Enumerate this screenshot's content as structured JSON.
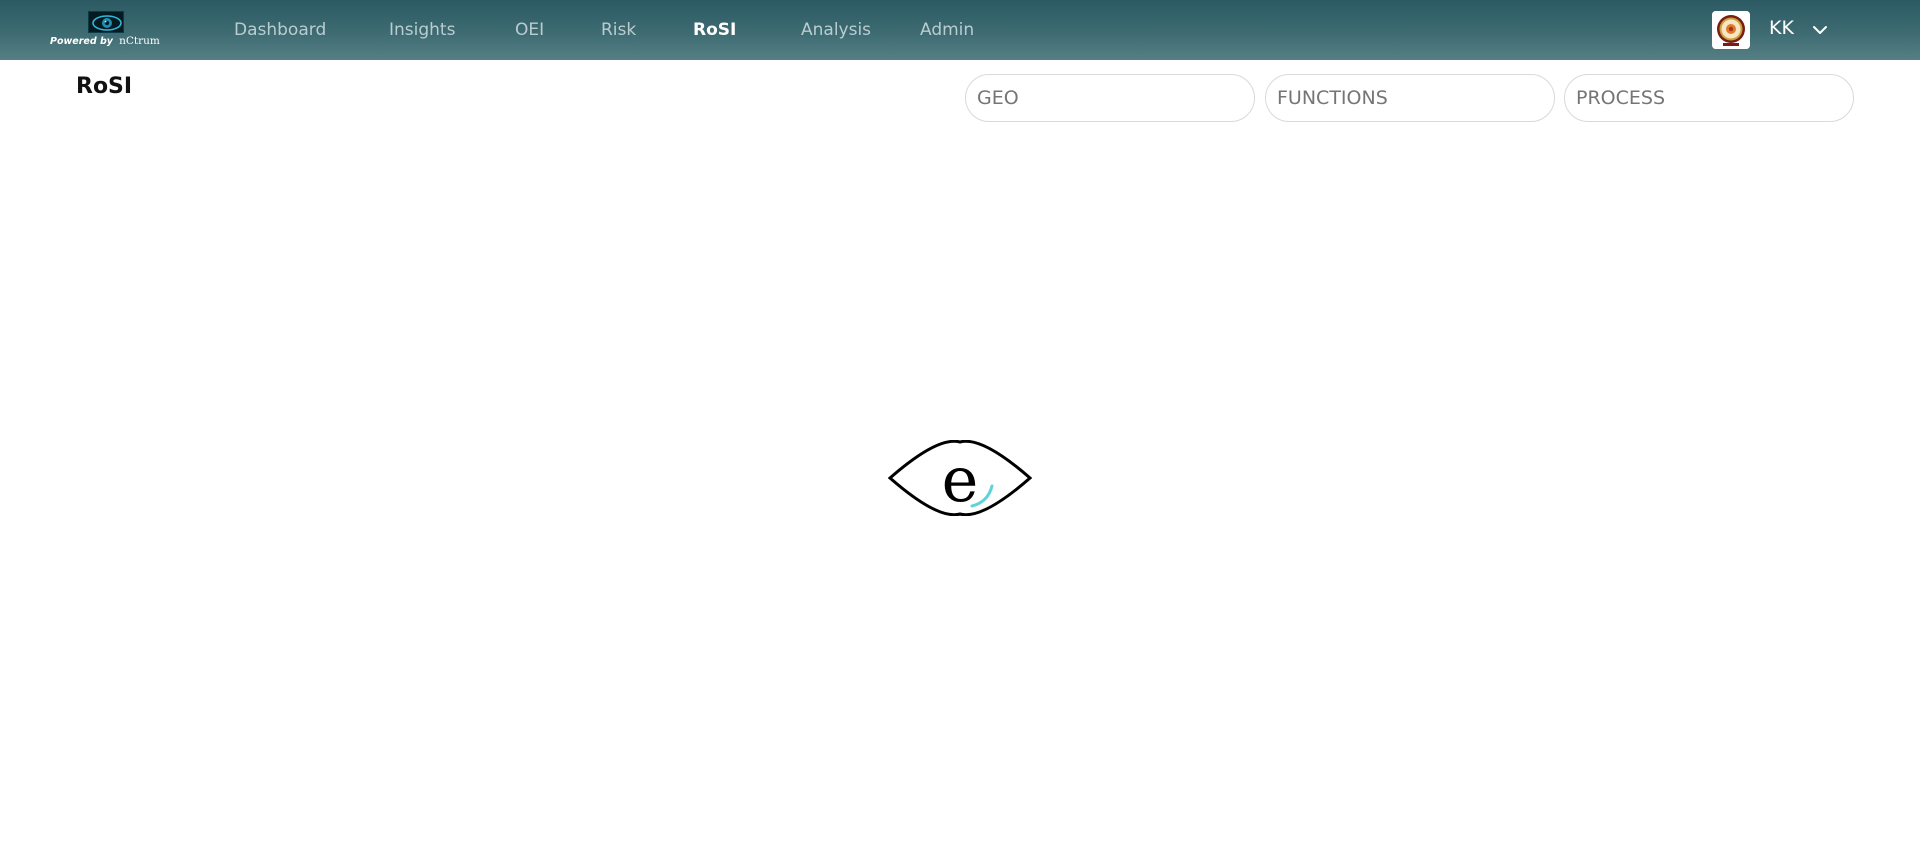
{
  "brand": {
    "logo_icon": "eye-logo-icon",
    "powered_by": "Powered by",
    "name": "nCtrum"
  },
  "nav": {
    "items": [
      {
        "label": "Dashboard",
        "active": false
      },
      {
        "label": "Insights",
        "active": false
      },
      {
        "label": "OEI",
        "active": false
      },
      {
        "label": "Risk",
        "active": false
      },
      {
        "label": "RoSI",
        "active": true
      },
      {
        "label": "Analysis",
        "active": false
      },
      {
        "label": "Admin",
        "active": false
      }
    ]
  },
  "user": {
    "avatar_icon": "organization-seal-icon",
    "initials": "KK",
    "menu_icon": "chevron-down-icon"
  },
  "page": {
    "title": "RoSI"
  },
  "filters": {
    "geo": {
      "placeholder": "GEO",
      "value": ""
    },
    "functions": {
      "placeholder": "FUNCTIONS",
      "value": ""
    },
    "process": {
      "placeholder": "PROCESS",
      "value": ""
    }
  },
  "loader": {
    "icon": "eye-e-loader-icon",
    "letter": "e"
  },
  "colors": {
    "header_top": "#2c5a63",
    "header_bottom": "#557f85",
    "nav_inactive": "#b9cdd0",
    "nav_active": "#ffffff",
    "loader_accent": "#5fd3dc"
  }
}
